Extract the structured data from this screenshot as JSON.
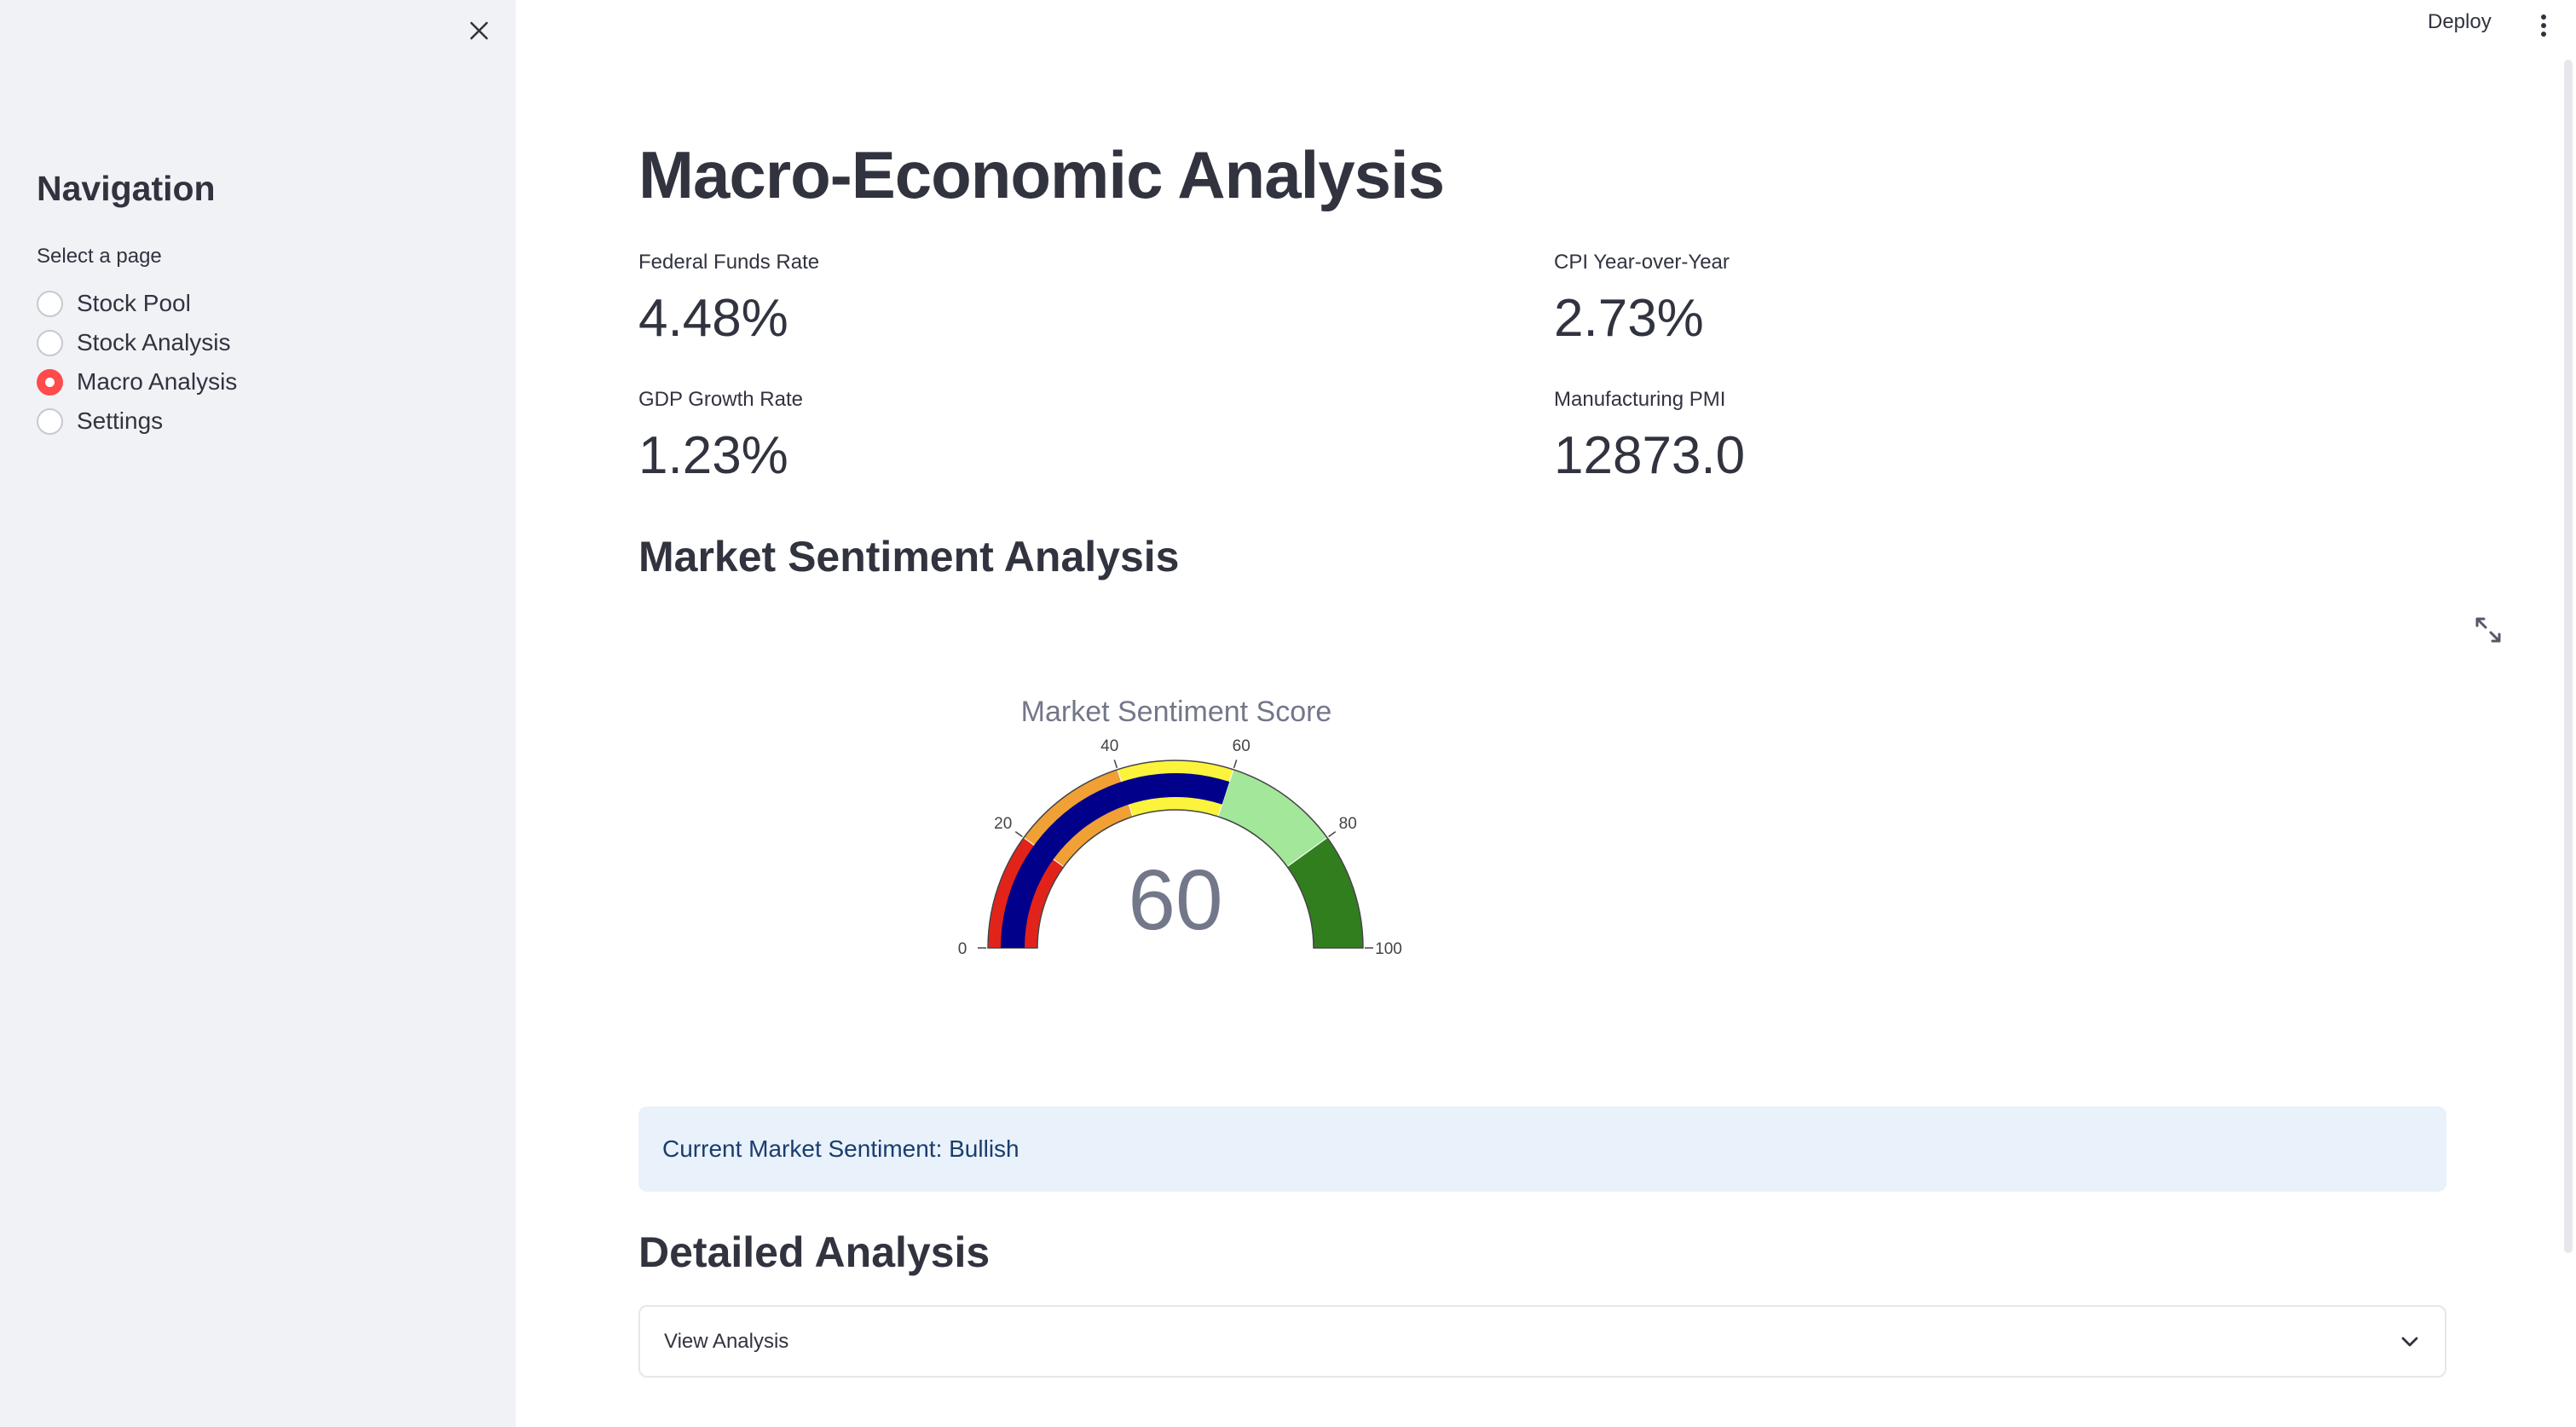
{
  "topbar": {
    "deploy_label": "Deploy",
    "menu_icon": "more-vertical-icon"
  },
  "sidebar": {
    "close_icon": "close-icon",
    "title": "Navigation",
    "radio_caption": "Select a page",
    "items": [
      {
        "label": "Stock Pool",
        "selected": false
      },
      {
        "label": "Stock Analysis",
        "selected": false
      },
      {
        "label": "Macro Analysis",
        "selected": true
      },
      {
        "label": "Settings",
        "selected": false
      }
    ],
    "accent_color": "#ff4b4b",
    "background_color": "#f0f2f6"
  },
  "main": {
    "title": "Macro-Economic Analysis",
    "metrics": [
      {
        "label": "Federal Funds Rate",
        "value": "4.48%"
      },
      {
        "label": "CPI Year-over-Year",
        "value": "2.73%"
      },
      {
        "label": "GDP Growth Rate",
        "value": "1.23%"
      },
      {
        "label": "Manufacturing PMI",
        "value": "12873.0"
      }
    ],
    "sentiment_heading": "Market Sentiment Analysis",
    "expand_icon": "fullscreen-icon",
    "info_text": "Current Market Sentiment: Bullish",
    "info_color": "#e9f1fb",
    "detailed_heading": "Detailed Analysis",
    "expander_label": "View Analysis",
    "expander_icon": "chevron-down-icon"
  },
  "chart_data": {
    "type": "gauge",
    "title": "Market Sentiment Score",
    "value": 60,
    "value_label": "60",
    "range": [
      0,
      100
    ],
    "tick_values": [
      0,
      20,
      40,
      60,
      80,
      100
    ],
    "tick_labels": [
      "0",
      "20",
      "40",
      "60",
      "80",
      "100"
    ],
    "steps": [
      {
        "range": [
          0,
          20
        ],
        "color": "#e2231a"
      },
      {
        "range": [
          20,
          40
        ],
        "color": "#f0a035"
      },
      {
        "range": [
          40,
          60
        ],
        "color": "#fcf33c"
      },
      {
        "range": [
          60,
          80
        ],
        "color": "#a3e79a"
      },
      {
        "range": [
          80,
          100
        ],
        "color": "#317e1f"
      }
    ],
    "bar_color": "#01008a"
  }
}
